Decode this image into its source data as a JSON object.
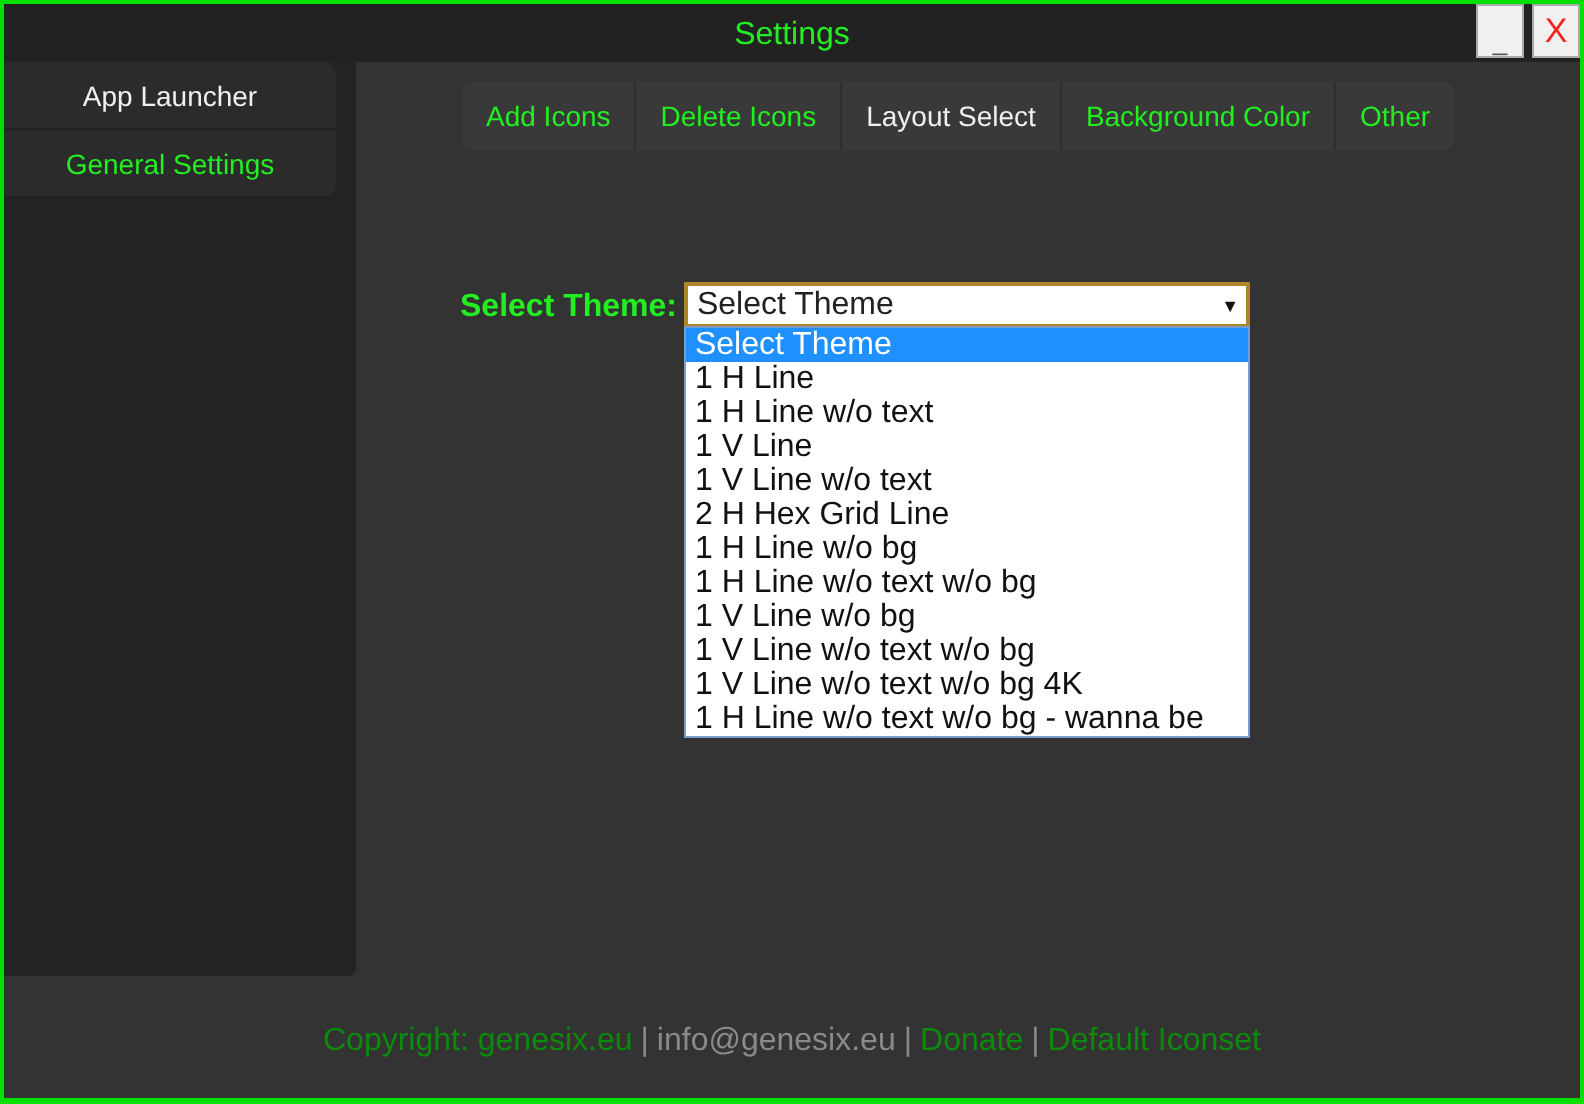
{
  "window": {
    "title": "Settings",
    "buttons": [
      {
        "kind": "minimize",
        "label": "_"
      },
      {
        "kind": "close",
        "label": "X"
      }
    ]
  },
  "sidebar": {
    "items": [
      {
        "label": "App Launcher",
        "kind": "heading"
      },
      {
        "label": "General Settings",
        "kind": "link"
      }
    ]
  },
  "tabs": [
    {
      "label": "Add Icons",
      "selected": false
    },
    {
      "label": "Delete Icons",
      "selected": false
    },
    {
      "label": "Layout Select",
      "selected": true
    },
    {
      "label": "Background Color",
      "selected": false
    },
    {
      "label": "Other",
      "selected": false
    }
  ],
  "theme_select": {
    "label": "Select Theme:",
    "value": "Select Theme",
    "caret": "▼",
    "expanded": true,
    "options": [
      {
        "label": "Select Theme",
        "selected": true
      },
      {
        "label": "1 H Line",
        "selected": false
      },
      {
        "label": "1 H Line w/o text",
        "selected": false
      },
      {
        "label": "1 V Line",
        "selected": false
      },
      {
        "label": "1 V Line w/o text",
        "selected": false
      },
      {
        "label": "2 H Hex Grid Line",
        "selected": false
      },
      {
        "label": "1 H Line w/o bg",
        "selected": false
      },
      {
        "label": "1 H Line w/o text w/o bg",
        "selected": false
      },
      {
        "label": "1 V Line w/o bg",
        "selected": false
      },
      {
        "label": "1 V Line w/o text w/o bg",
        "selected": false
      },
      {
        "label": "1 V Line w/o text w/o bg 4K",
        "selected": false
      },
      {
        "label": "1 H Line w/o text w/o bg - wanna be",
        "selected": false
      }
    ]
  },
  "footer": [
    {
      "text": "Copyright: genesix.eu",
      "kind": "link"
    },
    {
      "text": "|",
      "kind": "separator"
    },
    {
      "text": "info@genesix.eu",
      "kind": "text"
    },
    {
      "text": "|",
      "kind": "separator"
    },
    {
      "text": "Donate",
      "kind": "link"
    },
    {
      "text": "|",
      "kind": "separator"
    },
    {
      "text": "Default Iconset",
      "kind": "link"
    }
  ]
}
